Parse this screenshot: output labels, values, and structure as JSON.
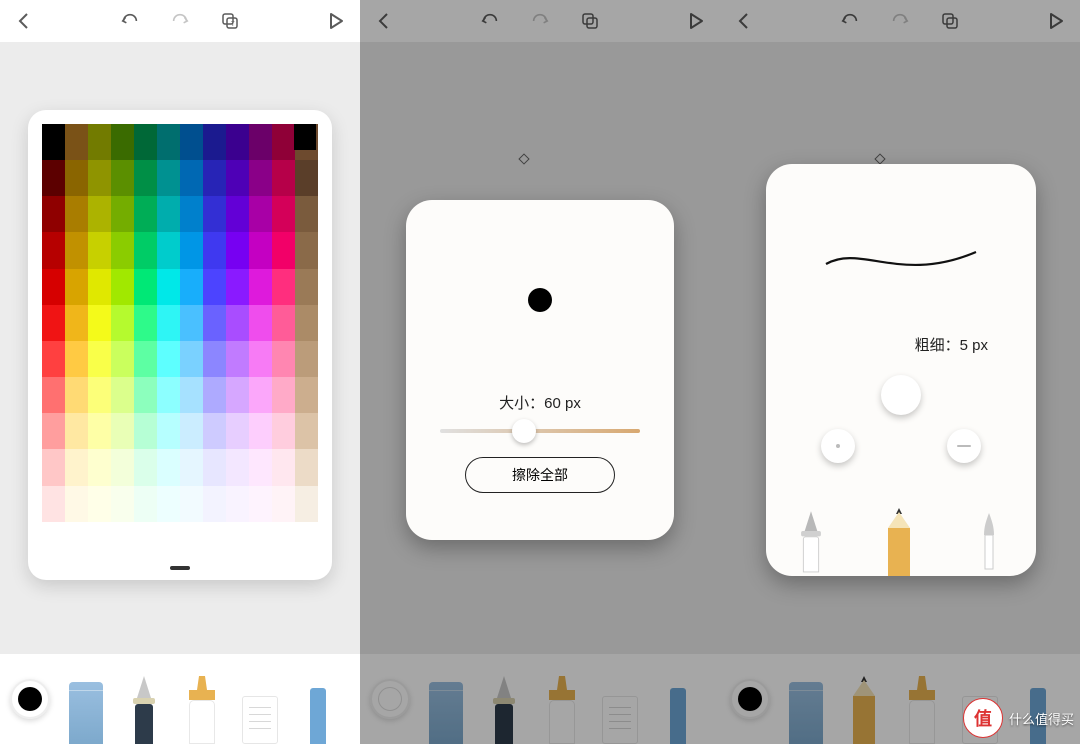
{
  "toolbar": {
    "back": "back",
    "undo": "undo",
    "redo": "redo",
    "layers": "layers",
    "play": "play"
  },
  "pane1": {
    "current_color": "#000000",
    "palette": [
      [
        "#000000",
        "#7a5217",
        "#727b00",
        "#3a6b00",
        "#006837",
        "#006e6e",
        "#004f8f",
        "#1b1a8f",
        "#3b008f",
        "#6b0069",
        "#8f0037",
        "#6d4a2e"
      ],
      [
        "#5c0000",
        "#8a6500",
        "#8f9400",
        "#5b8f00",
        "#008f46",
        "#009191",
        "#0068b3",
        "#2724b6",
        "#4e00b6",
        "#8a0088",
        "#b60049",
        "#5a3e29"
      ],
      [
        "#8f0000",
        "#a97d00",
        "#acb300",
        "#74ad00",
        "#00ad56",
        "#00adad",
        "#0080cc",
        "#332fd4",
        "#6300d6",
        "#a800a6",
        "#d40059",
        "#7a5b3d"
      ],
      [
        "#b60000",
        "#c19100",
        "#c7d000",
        "#8bcc00",
        "#00cc66",
        "#00cccc",
        "#0096e6",
        "#3f39f0",
        "#7700f2",
        "#c400c2",
        "#f20068",
        "#8a6a49"
      ],
      [
        "#d60000",
        "#d8a400",
        "#e0e800",
        "#a1e800",
        "#00e876",
        "#00e8e8",
        "#18aefb",
        "#4c44ff",
        "#8a1aff",
        "#de1adc",
        "#ff2e7e",
        "#9a7a57"
      ],
      [
        "#f01414",
        "#f0b61a",
        "#f4fa1a",
        "#b5fa2e",
        "#2efa8a",
        "#2ef5f5",
        "#4ac0ff",
        "#6a62ff",
        "#a94dff",
        "#ef4ded",
        "#ff5c98",
        "#ab8b67"
      ],
      [
        "#ff4040",
        "#ffca43",
        "#f9ff49",
        "#caff5d",
        "#5dffa3",
        "#5dffff",
        "#7ad1ff",
        "#8c86ff",
        "#c17bff",
        "#f77bf5",
        "#ff86b1",
        "#bb9c7a"
      ],
      [
        "#ff7070",
        "#ffda74",
        "#fcff79",
        "#dbff8c",
        "#8cffbd",
        "#8cffff",
        "#a6e1ff",
        "#aeaaff",
        "#d6a7ff",
        "#fba7fa",
        "#ffaac8",
        "#ccae8e"
      ],
      [
        "#ff9e9e",
        "#ffe8a2",
        "#feffa6",
        "#e9ffb6",
        "#b6ffd5",
        "#b6ffff",
        "#cbedff",
        "#cecbff",
        "#e7ceff",
        "#fdceFD",
        "#ffcdde",
        "#dcc3a7"
      ],
      [
        "#ffc7c7",
        "#fff3cc",
        "#feffcf",
        "#f3ffda",
        "#daffea",
        "#daffff",
        "#e5f6ff",
        "#e7e6ff",
        "#f3e7ff",
        "#fee7fe",
        "#ffe7ef",
        "#ecdbc7"
      ],
      [
        "#ffe3e3",
        "#fff9e6",
        "#ffffe8",
        "#f9ffed",
        "#edfff5",
        "#edffff",
        "#f2fbff",
        "#f3f3ff",
        "#f9f3ff",
        "#fef3fe",
        "#fff3f7",
        "#f6eee3"
      ],
      [
        "#ffffff",
        "#ffffff",
        "#ffffff",
        "#ffffff",
        "#ffffff",
        "#ffffff",
        "#ffffff",
        "#ffffff",
        "#ffffff",
        "#ffffff",
        "#ffffff",
        "#ffffff"
      ]
    ]
  },
  "pane2": {
    "size_label": "大小：",
    "size_value": "60 px",
    "erase_all": "擦除全部",
    "swatch_color": "transparent"
  },
  "pane3": {
    "thickness_label": "粗细：",
    "thickness_value": "5 px",
    "swatch_color": "#000000"
  },
  "watermark": {
    "badge": "值",
    "text": "什么值得买"
  }
}
